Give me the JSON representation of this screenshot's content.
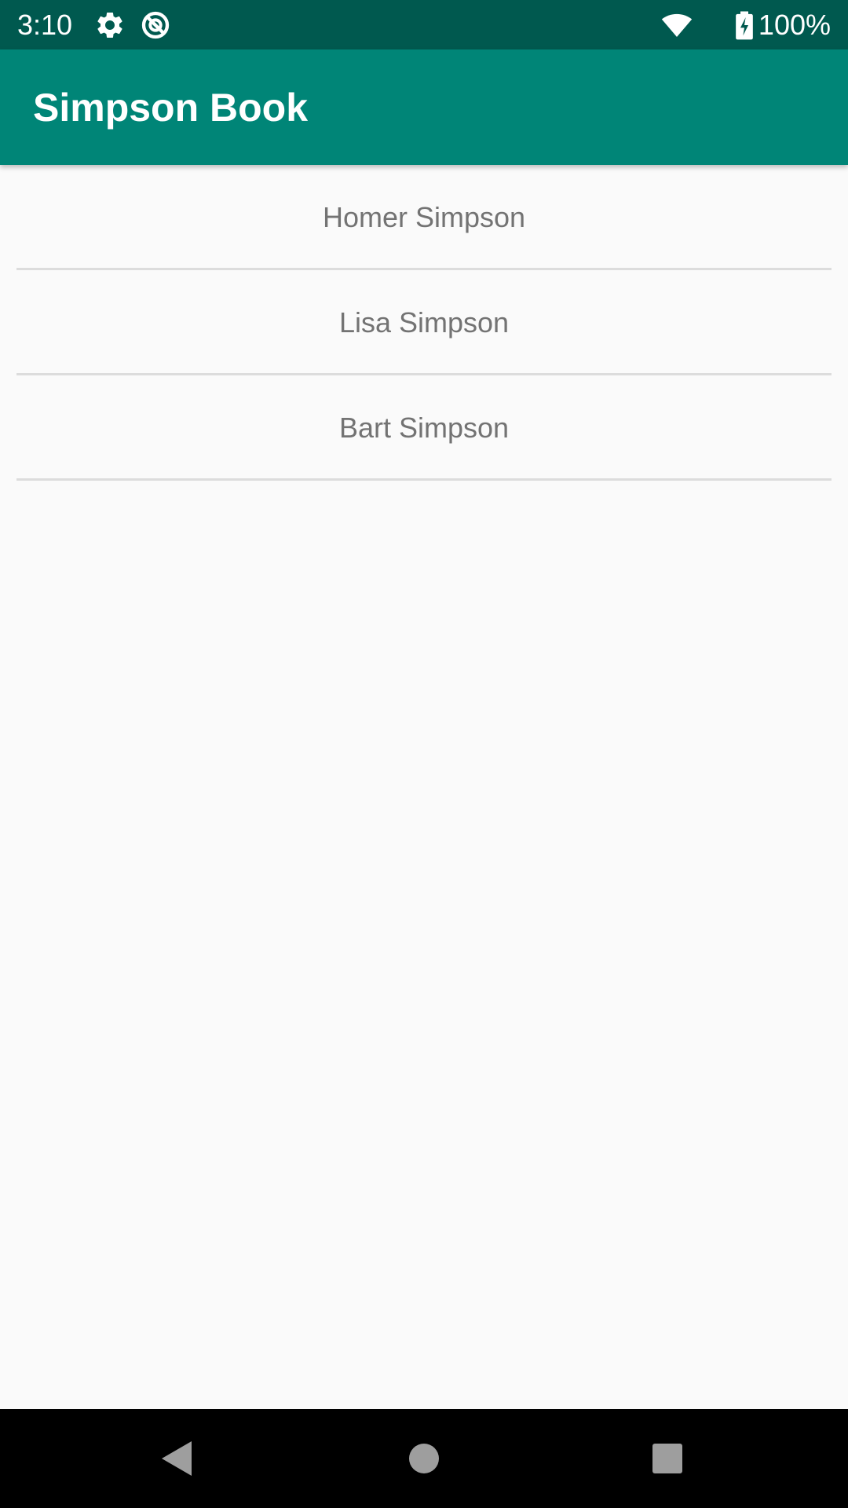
{
  "status_bar": {
    "time": "3:10",
    "battery_percent": "100%",
    "icons": [
      "settings-gear-icon",
      "do-not-disturb-icon",
      "wifi-icon",
      "battery-charging-icon"
    ],
    "background_color": "#00594f"
  },
  "app_bar": {
    "title": "Simpson Book",
    "background_color": "#008577"
  },
  "list": {
    "items": [
      {
        "label": "Homer Simpson"
      },
      {
        "label": "Lisa Simpson"
      },
      {
        "label": "Bart Simpson"
      }
    ]
  },
  "nav_bar": {
    "buttons": [
      "back-icon",
      "home-icon",
      "recents-icon"
    ]
  }
}
